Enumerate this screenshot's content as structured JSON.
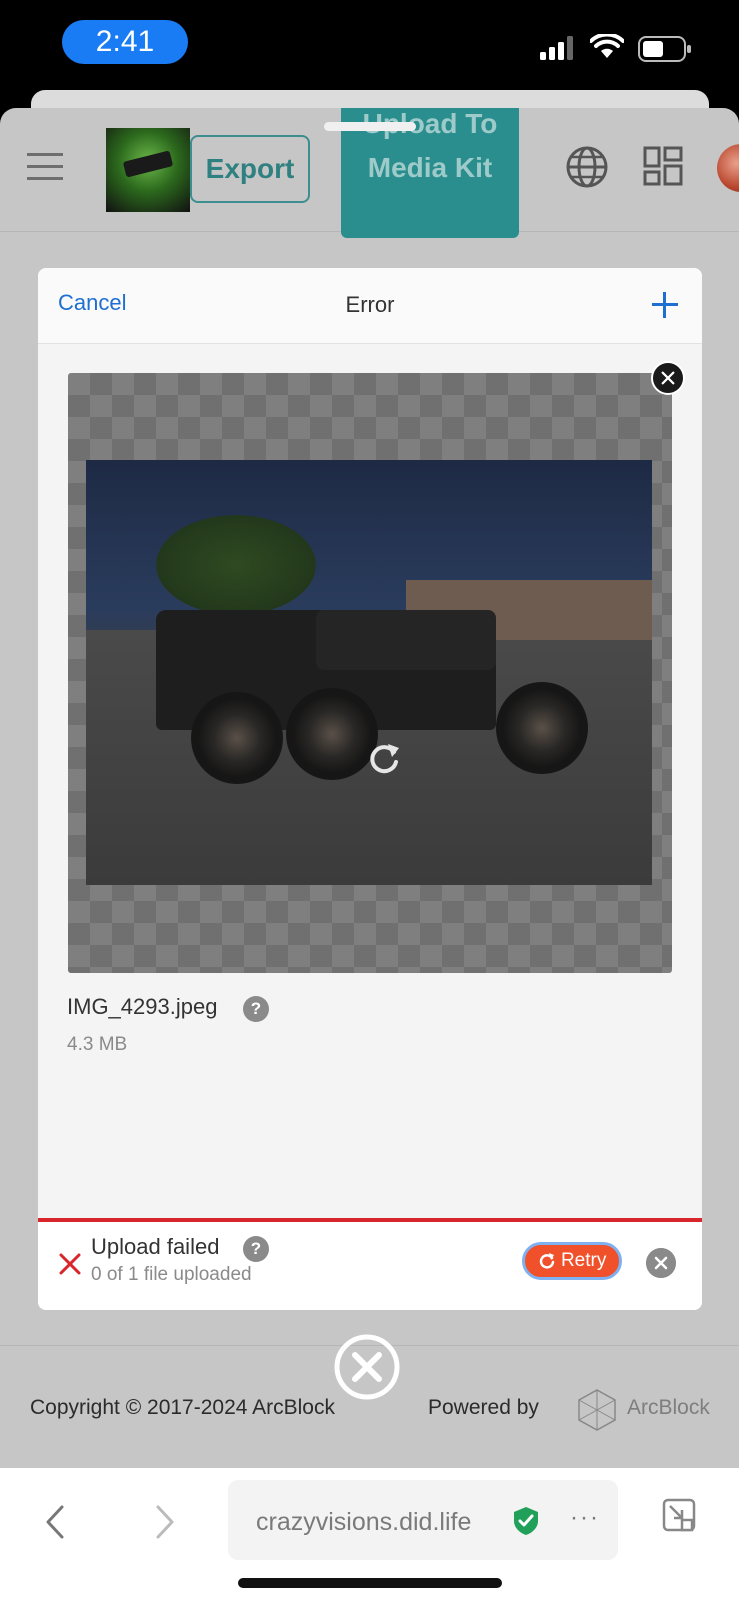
{
  "status": {
    "time": "2:41"
  },
  "header": {
    "export_label": "Export",
    "upload_label": "Upload To Media Kit"
  },
  "dialog": {
    "cancel": "Cancel",
    "title": "Error",
    "file": {
      "name": "IMG_4293.jpeg",
      "size": "4.3 MB"
    },
    "status": {
      "title": "Upload failed",
      "subtitle": "0 of 1 file uploaded",
      "retry_label": "Retry"
    }
  },
  "footer": {
    "copyright": "Copyright © 2017-2024  ArcBlock",
    "powered_by": "Powered by",
    "brand": "ArcBlock"
  },
  "browser": {
    "url": "crazyvisions.did.life"
  },
  "colors": {
    "accent": "#1f6fd1",
    "teal": "#2a8e8e",
    "error": "#d9262c",
    "retry": "#f0502a"
  }
}
